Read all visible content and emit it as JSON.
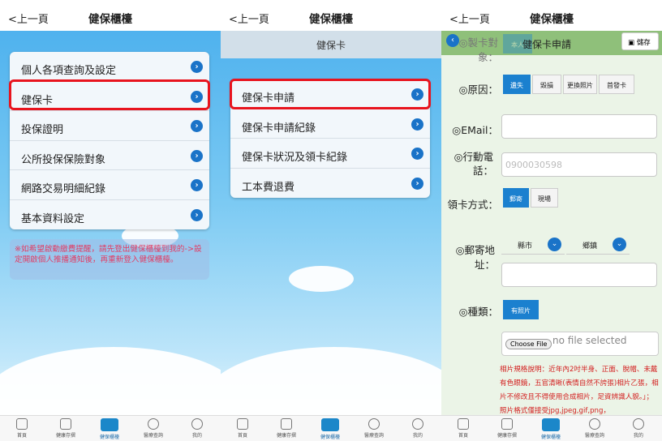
{
  "panel1": {
    "back": "<上一頁",
    "title": "健保櫃檯",
    "menu": [
      "個人各項查詢及設定",
      "健保卡",
      "投保證明",
      "公所投保保險對象",
      "網路交易明細紀錄",
      "基本資料設定"
    ],
    "notice": "※如希望啟動繳費提醒，請先登出健保櫃檯到我的->設定開啟個人推播通知後，再重新登入健保櫃檯。"
  },
  "panel2": {
    "back": "<上一頁",
    "title": "健保櫃檯",
    "subtitle": "健保卡",
    "menu": [
      "健保卡申請",
      "健保卡申請紀錄",
      "健保卡狀況及領卡紀錄",
      "工本費退費"
    ]
  },
  "panel3": {
    "back": "<上一頁",
    "title": "健保櫃檯",
    "header_title": "健保卡申請",
    "save": "儲存",
    "target_label": "◎製卡對象：",
    "target_value": "本人",
    "reason_label": "◎原因：",
    "reasons": [
      "遺失",
      "毀損",
      "更換照片",
      "首發卡"
    ],
    "email_label": "◎EMail：",
    "mobile_label": "◎行動電話：",
    "mobile_placeholder": "0900030598",
    "pickup_label": "領卡方式：",
    "pickup": [
      "郵寄",
      "現場"
    ],
    "address_label": "◎郵寄地址：",
    "city": "縣市",
    "town": "鄉鎮",
    "type_label": "◎種類：",
    "type": "有照片",
    "file_button": "Choose File",
    "file_status": "no file selected",
    "photo_note": "相片規格說明：近年內2吋半身、正面、脫帽、未戴有色眼鏡，五官清晰(表情自然不誇張)相片乙張，相片不修改且不得使用合成相片，足資辨識人貌。」；照片格式僅接受jpg,jpeg,gif,png，"
  },
  "nav": [
    "首頁",
    "健康存摺",
    "健保櫃檯",
    "醫療查詢",
    "我的"
  ]
}
